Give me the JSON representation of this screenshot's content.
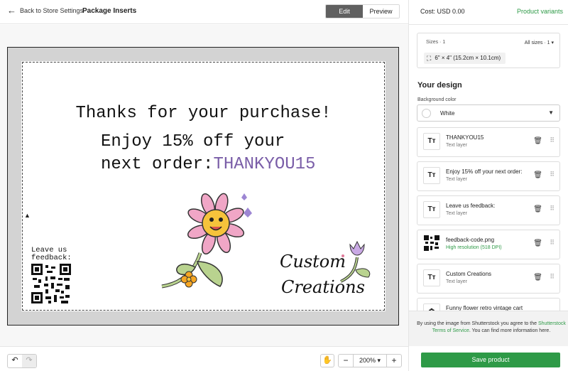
{
  "header": {
    "back_label": "Back to Store Settings",
    "title": "Package Inserts",
    "edit_label": "Edit",
    "preview_label": "Preview"
  },
  "card": {
    "line1": "Thanks for your purchase!",
    "line2a": "Enjoy 15% off your",
    "line2b": "next order:",
    "code": "THANKYOU15",
    "feedback_label_1": "Leave us",
    "feedback_label_2": "feedback:",
    "custom_1": "Custom",
    "custom_2": "Creations"
  },
  "toolbar": {
    "zoom": "200%"
  },
  "sidebar": {
    "cost": "Cost: USD 0.00",
    "variants_link": "Product variants",
    "sizes_count": "Sizes · 1",
    "all_sizes": "All sizes · 1",
    "size_value": "6\" × 4\" (15.2cm × 10.1cm)",
    "your_design": "Your design",
    "bg_label": "Background color",
    "bg_value": "White",
    "layers": [
      {
        "name": "THANKYOU15",
        "type": "Text layer"
      },
      {
        "name": "Enjoy 15% off your next order:",
        "type": "Text layer"
      },
      {
        "name": "Leave us feedback:",
        "type": "Text layer"
      },
      {
        "name": "feedback-code.png",
        "type": "High resolution (518 DPI)"
      },
      {
        "name": "Custom Creations",
        "type": "Text layer"
      },
      {
        "name": "Funny flower retro vintage cart",
        "type": ""
      }
    ],
    "notice_1": "By using the image from Shutterstock you agree to the",
    "notice_link": "Shutterstock Terms of Service",
    "notice_2": ". You can find more information here.",
    "save_label": "Save product"
  },
  "colors": {
    "accent": "#2e9a47",
    "code": "#7a5ea8"
  }
}
